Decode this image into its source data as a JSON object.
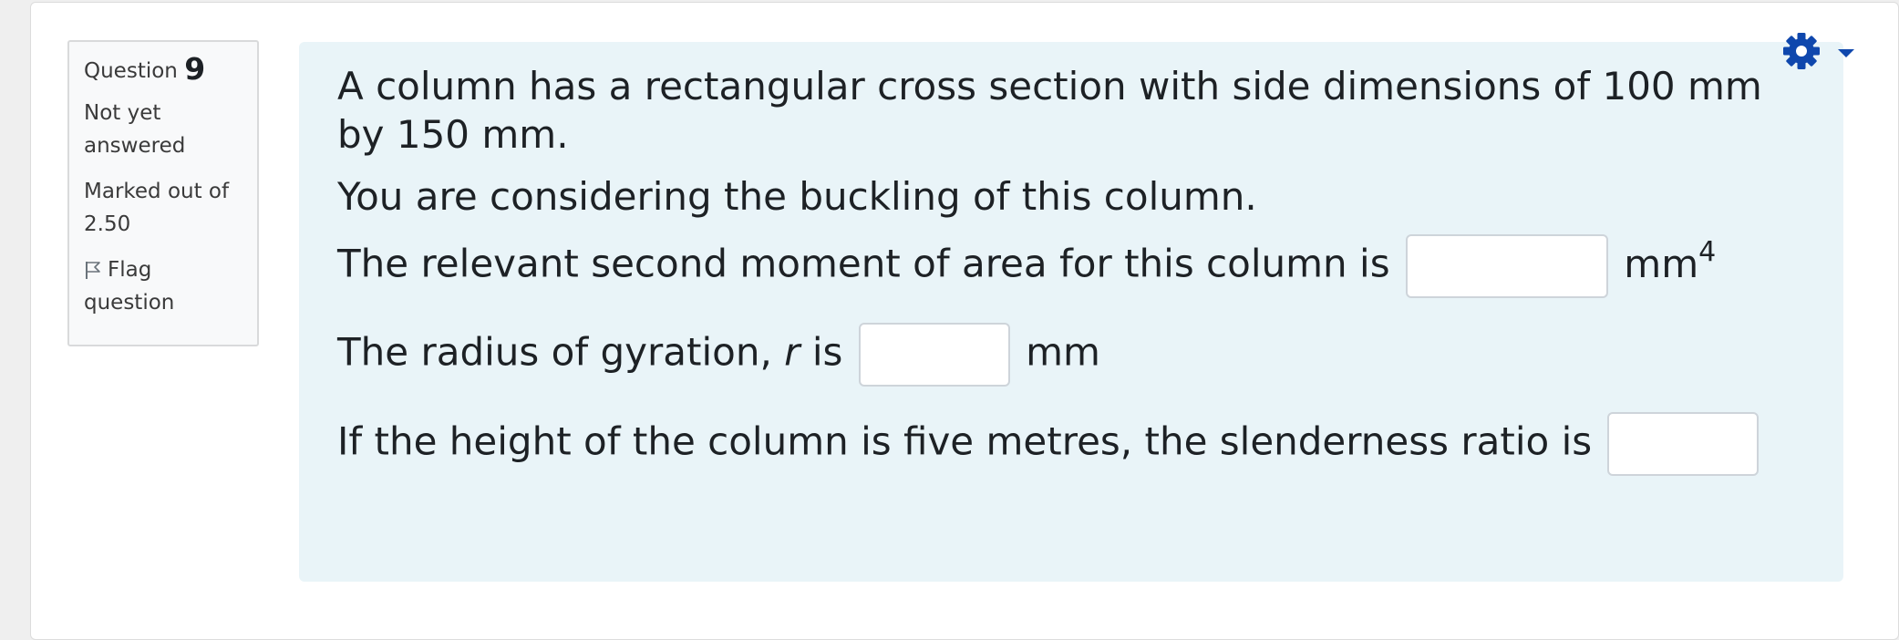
{
  "question_info": {
    "question_label": "Question",
    "question_number": "9",
    "status": "Not yet answered",
    "mark_text": "Marked out of 2.50",
    "flag_label": "Flag question"
  },
  "question": {
    "para1": "A column has a rectangular cross section with side dimensions of 100 mm by 150 mm.",
    "para2": "You are considering the buckling of this column.",
    "line_i": {
      "prefix": "The relevant second moment of area for this column is",
      "unit": "mm",
      "unit_exponent": "4",
      "value": ""
    },
    "line_r": {
      "prefix": "The radius of gyration,",
      "symbol": "r",
      "verb": "is",
      "unit": "mm",
      "value": ""
    },
    "line_s": {
      "prefix": "If the height of the column is five metres, the slenderness ratio is",
      "value": ""
    }
  },
  "colors": {
    "content_background": "#e9f4f8",
    "info_background": "#f8f9fa",
    "gear_icon": "#0f47ad"
  },
  "icons": {
    "flag": "flag-outline-icon",
    "gear": "gear-icon",
    "caret": "caret-down-icon"
  }
}
